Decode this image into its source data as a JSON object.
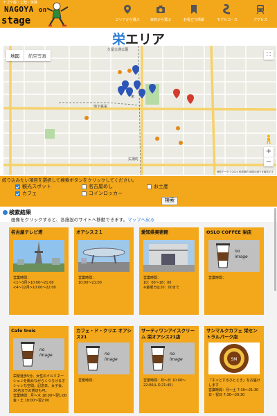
{
  "header": {
    "logo_subtitle": "ナゴヤ版・上陸・体験",
    "logo_line1": "NAGOYA",
    "logo_line1b": "on",
    "logo_line2": "stage",
    "nav": [
      {
        "label": "エリアから選ぶ",
        "icon": "map-pin-icon"
      },
      {
        "label": "目的から選ぶ",
        "icon": "camera-icon"
      },
      {
        "label": "お役立ち情報",
        "icon": "bookmark-icon"
      },
      {
        "label": "モデルコース",
        "icon": "route-icon"
      },
      {
        "label": "アクセス",
        "icon": "train-icon"
      }
    ]
  },
  "title": {
    "highlight": "栄",
    "rest": "エリア"
  },
  "map": {
    "tab_map": "地図",
    "tab_satellite": "航空写真",
    "attribution": "地図データ ©2024 利用規約 地図の誤りを報告する",
    "labels": [
      "久屋大通公園",
      "栄",
      "地下鉄栄",
      "矢場町"
    ]
  },
  "filter": {
    "instruction": "絞り込みたい項目を選択して検索ボタンをクリックしてください。",
    "options": [
      {
        "label": "観光スポット",
        "checked": true
      },
      {
        "label": "名古屋めし",
        "checked": false
      },
      {
        "label": "お土産",
        "checked": false
      },
      {
        "label": "カフェ",
        "checked": true
      },
      {
        "label": "コインロッカー",
        "checked": false
      }
    ],
    "search_label": "検索"
  },
  "results": {
    "heading": "検索結果",
    "subtext": "画像をクリックすると、各施設のサイトへ移動できます。",
    "back_link": "マップへ戻る",
    "no_image_line1": "no",
    "no_image_line2": "image",
    "cards": [
      {
        "name": "名古屋テレビ塔",
        "image": "tower-photo",
        "hours": "営業時間：\n<1～3月>10:00～21:00\n<4～12月>10:00～22:00"
      },
      {
        "name": "オアシス２１",
        "image": "oasis-photo",
        "hours": "営業時間：\n10:00～21:00"
      },
      {
        "name": "愛知県美術館",
        "image": "museum-photo",
        "hours": "営業時間：\n10：00～18：00\n※金曜日は20：00まで"
      },
      {
        "name": "OSLO COFFEE 栄店",
        "image": "no-image",
        "hours": "営業時間："
      },
      {
        "name": "Cafe trois",
        "image": "no-image",
        "hours": "栄駅徒歩5分。女性のイルミネーションを眺めながらくつろげるオシャレな空間。記念日、女子会、30名までの貸切も可。\n営業時間：月～木 18:00～翌1:00 金・土 18:00～翌2:00"
      },
      {
        "name": "カフェ・ド・クリエ オアシス21",
        "image": "no-image",
        "hours": "営業時間："
      },
      {
        "name": "サーティワンアイスクリーム 栄オアシス21店",
        "image": "no-image",
        "hours": "営業時間：月～日 10:00～22:00(L.O.21:45)"
      },
      {
        "name": "サンマルクカフェ 栄セントラルパーク店",
        "image": "saint-marc-logo",
        "hours": "「ホッとするひととき」をお届けします\n営業時間：月～土 7:30～21:30 日・祝日 7:30～20:30"
      }
    ]
  },
  "colors": {
    "accent": "#f3a71a",
    "link": "#2f7fd3"
  }
}
